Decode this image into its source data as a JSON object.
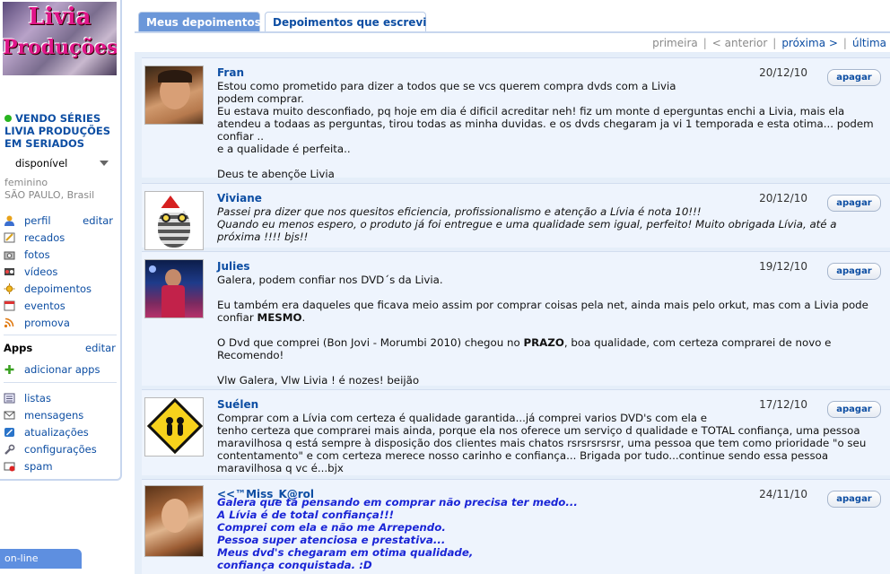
{
  "logo": {
    "line1": "Livia",
    "line2": "Produções"
  },
  "profile": {
    "name": "VENDO SÉRIES LIVIA PRODUÇÕES EM SERIADOS",
    "status": "disponível",
    "gender": "feminino",
    "location": "SÃO PAULO, Brasil"
  },
  "menu": {
    "edit_label": "editar",
    "items": [
      "perfil",
      "recados",
      "fotos",
      "vídeos",
      "depoimentos",
      "eventos",
      "promova"
    ],
    "apps_title": "Apps",
    "apps_edit": "editar",
    "add_apps": "adicionar apps",
    "bottom": [
      "listas",
      "mensagens",
      "atualizações",
      "configurações",
      "spam"
    ],
    "online_label": "on-line"
  },
  "tabs": [
    "Meus depoimentos",
    "Depoimentos que escrevi"
  ],
  "pager": {
    "first": "primeira",
    "prev": "< anterior",
    "next": "próxima >",
    "last": "última"
  },
  "delete_label": "apagar",
  "testimonials": [
    {
      "author": "Fran",
      "date": "20/12/10",
      "lines": [
        "Estou como prometido para dizer a todos que se vcs querem compra dvds com a Livia",
        "podem comprar.",
        "Eu estava muito desconfiado, pq hoje em dia é dificil acreditar neh! fiz um monte d eperguntas enchi a Livia, mais ela atendeu a todaas as perguntas, tirou todas as minha duvidas. e os dvds chegaram ja vi 1 temporada e esta otima... podem confiar ..",
        "e a qualidade é perfeita..",
        "",
        "Deus te abençõe Livia"
      ]
    },
    {
      "author": "Viviane",
      "date": "20/12/10",
      "lines": [
        "Passei pra dizer que nos quesitos eficiencia, profissionalismo e atenção a Lívia é nota 10!!!",
        "Quando eu menos espero, o produto já foi entregue e uma qualidade sem igual, perfeito! Muito obrigada Lívia, até a próxima !!!! bjs!!"
      ]
    },
    {
      "author": "Julies",
      "date": "19/12/10",
      "p1": "Galera, podem confiar nos DVD´s da Livia.",
      "p2a": "Eu também era daqueles que ficava meio assim por comprar coisas pela net, ainda mais pelo orkut, mas com a Livia pode confiar ",
      "p2b": "MESMO",
      "p2c": ".",
      "p3a": "O Dvd que comprei (Bon Jovi - Morumbi 2010) chegou no ",
      "p3b": "PRAZO",
      "p3c": ", boa qualidade, com certeza comprarei de novo e Recomendo!",
      "p4": "Vlw Galera, Vlw Livia ! é nozes! beijão"
    },
    {
      "author": "Suélen",
      "date": "17/12/10",
      "lines": [
        "Comprar com a Lívia com certeza é qualidade garantida...já comprei varios DVD's com ela e",
        "tenho certeza que comprarei mais ainda, porque ela nos oferece um serviço d qualidade e TOTAL confiança, uma pessoa maravilhosa q está sempre à disposição dos clientes mais chatos rsrsrsrsrsr, uma pessoa que tem como prioridade \"o seu contentamento\" e com certeza merece nosso carinho e confiança... Brigada por tudo...continue sendo essa pessoa maravilhosa q vc é...bjx"
      ]
    },
    {
      "author": "<<™Miss_K@rol",
      "date": "24/11/10",
      "lines": [
        "Galera que tá pensando em comprar não precisa ter medo...",
        "A Lívia é de total confiança!!!",
        "Comprei com ela e não me Arrependo.",
        "Pessoa super atenciosa e prestativa...",
        "Meus dvd's chegaram em otima qualidade,",
        "confiança conquistada. :D"
      ]
    }
  ]
}
